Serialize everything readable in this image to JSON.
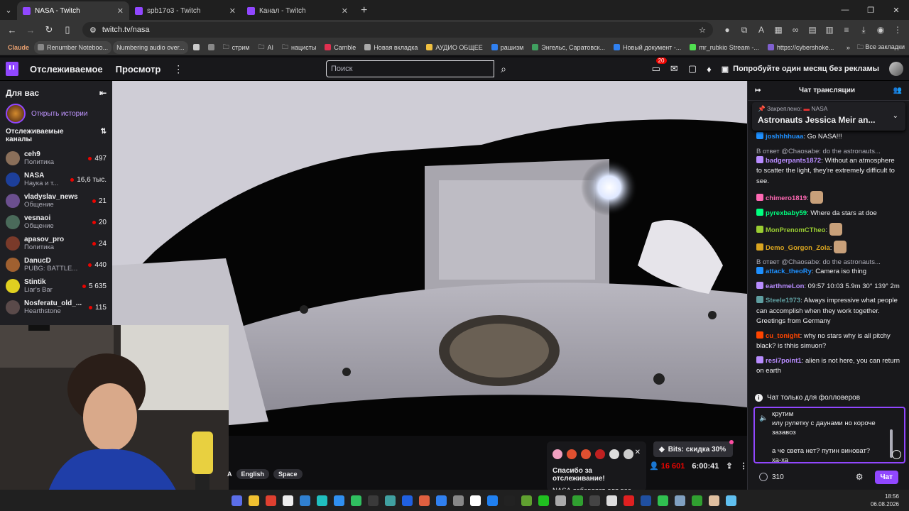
{
  "browser": {
    "tabs": [
      {
        "title": "NASA - Twitch",
        "active": true
      },
      {
        "title": "spb17o3 - Twitch",
        "active": false
      },
      {
        "title": "Канал - Twitch",
        "active": false
      }
    ],
    "url": "twitch.tv/nasa",
    "bookmarks": [
      "Claude",
      "Renumber Noteboo...",
      "Numbering audio over...",
      "стрим",
      "AI",
      "нацисты",
      "Camble",
      "Новая вкладка",
      "АУДИО ОБЩЕЕ",
      "рашизм",
      "Энгельс, Саратовск...",
      "Новый документ -...",
      "mr_rubkio Stream -...",
      "https://cybershoke..."
    ],
    "all_bookmarks": "Все закладки"
  },
  "nav": {
    "following": "Отслеживаемое",
    "browse": "Просмотр",
    "search_placeholder": "Поиск",
    "notif_count": "20",
    "promo": "Попробуйте один месяц без рекламы"
  },
  "sidebar": {
    "for_you": "Для вас",
    "stories": "Открыть истории",
    "section": "Отслеживаемые каналы",
    "channels": [
      {
        "name": "ceh9",
        "category": "Политика",
        "viewers": "497",
        "color": "#8a6f5a"
      },
      {
        "name": "NASA",
        "category": "Наука и т...",
        "viewers": "16,6 тыс.",
        "color": "#1d3f9a"
      },
      {
        "name": "vladyslav_news",
        "category": "Общение",
        "viewers": "21",
        "color": "#6b4f8f"
      },
      {
        "name": "vesnaoi",
        "category": "Общение",
        "viewers": "20",
        "color": "#4a6a5a"
      },
      {
        "name": "apasov_pro",
        "category": "Политика",
        "viewers": "24",
        "color": "#7a3a2a"
      },
      {
        "name": "DanucD",
        "category": "PUBG: BATTLE...",
        "viewers": "440",
        "color": "#a06030"
      },
      {
        "name": "Stintik",
        "category": "Liar's Bar",
        "viewers": "5 635",
        "color": "#e0d020"
      },
      {
        "name": "Nosferatu_old_...",
        "category": "Hearthstone",
        "viewers": "115",
        "color": "#5a4a4a"
      }
    ]
  },
  "stream": {
    "tags": [
      "A",
      "English",
      "Space"
    ],
    "follow_title": "Спасибо за отслеживание!",
    "follow_sub": "NASA добавляет для вас",
    "bits": "Bits: скидка 30%",
    "viewers": "16 601",
    "uptime": "6:00:41"
  },
  "chat": {
    "title": "Чат трансляции",
    "pinned_label": "Закреплено:",
    "pinned_by": "NASA",
    "pinned_text": "Astronauts Jessica Meir an...",
    "messages": [
      {
        "user": "joshhhhuaa",
        "color": "#1e90ff",
        "text": "Go NASA!!!"
      },
      {
        "reply": "В ответ @Chaosabe: do the astronauts...",
        "user": "badgerpants1872",
        "color": "#b88cff",
        "text": "Without an atmosphere to scatter the light, they're extremely difficult to see."
      },
      {
        "user": "chimero1819",
        "color": "#ff69b4",
        "text": ""
      },
      {
        "user": "pyrexbaby59",
        "color": "#00ff7f",
        "text": "Where da stars at doe"
      },
      {
        "user": "MonPrenomCTheo",
        "color": "#9acd32",
        "text": ""
      },
      {
        "user": "Demo_Gorgon_Zola",
        "color": "#daa520",
        "text": ""
      },
      {
        "reply": "В ответ @Chaosabe: do the astronauts...",
        "user": "attack_theoRy",
        "color": "#1e90ff",
        "text": "Camera iso thing"
      },
      {
        "user": "earthmeLon",
        "color": "#b88cff",
        "text": "09:57 10:03 5.9m 30° 139° 2m"
      },
      {
        "user": "Steele1973",
        "color": "#5f9ea0",
        "text": "Always impressive what people can accomplish when they work together. Greetings from Germany"
      },
      {
        "user": "cu_tonight",
        "color": "#ff4500",
        "text": "why no stars why is all pitchy black? is thhis simuon?"
      },
      {
        "user": "resi7point1",
        "color": "#b88cff",
        "text": "alien is not here, you can return on earth"
      }
    ],
    "follow_only": "Чат только для фолловеров",
    "input_lines": [
      "крутим",
      "илу рулетку с даунами но короче",
      "зазавоз",
      "",
      "а че света нет? путин виноват?",
      "ха-ха"
    ],
    "points": "310",
    "send": "Чат"
  },
  "taskbar": {
    "time": "18:56",
    "date": "06.08.2026"
  }
}
